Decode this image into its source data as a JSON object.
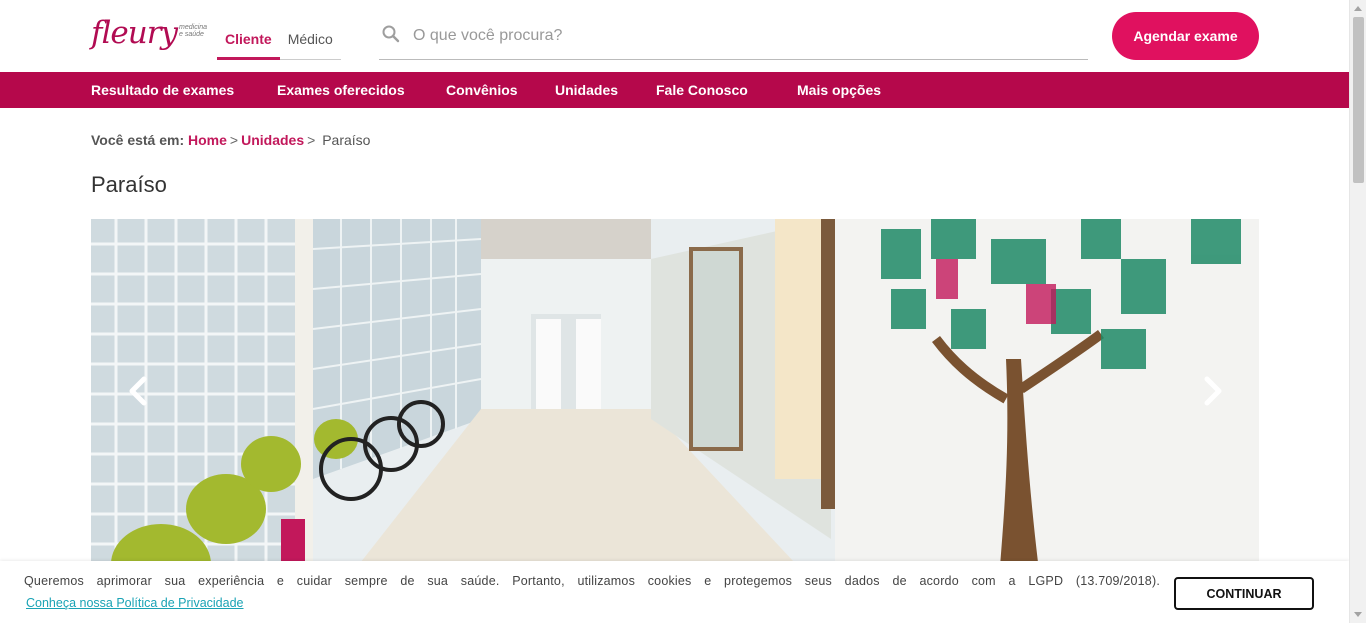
{
  "header": {
    "logo_text": "fleury",
    "logo_tagline": "medicina e saúde",
    "profile_tabs": [
      {
        "label": "Cliente",
        "active": true
      },
      {
        "label": "Médico",
        "active": false
      }
    ],
    "search_placeholder": "O que você procura?",
    "cta_label": "Agendar exame"
  },
  "nav": {
    "items": [
      {
        "label": "Resultado de exames"
      },
      {
        "label": "Exames oferecidos"
      },
      {
        "label": "Convênios"
      },
      {
        "label": "Unidades"
      },
      {
        "label": "Fale Conosco"
      },
      {
        "label": "Mais opções"
      }
    ]
  },
  "breadcrumb": {
    "prefix": "Você está em:",
    "items": [
      {
        "label": "Home",
        "separator": ">"
      },
      {
        "label": "Unidades",
        "separator": ">"
      },
      {
        "label": "Paraíso"
      }
    ]
  },
  "page": {
    "title": "Paraíso"
  },
  "carousel": {
    "prev_icon": "chevron-left-icon",
    "next_icon": "chevron-right-icon"
  },
  "cookie": {
    "text": "Queremos aprimorar sua experiência e cuidar sempre de sua saúde. Portanto, utilizamos cookies e protegemos seus dados de acordo com a LGPD (13.709/2018).",
    "link": "Conheça nossa Política de Privacidade",
    "button": "CONTINUAR"
  },
  "colors": {
    "brand": "#e0115f",
    "nav_bg": "#b5084b",
    "link": "#c2185b",
    "cookie_link": "#1aa3b5"
  }
}
